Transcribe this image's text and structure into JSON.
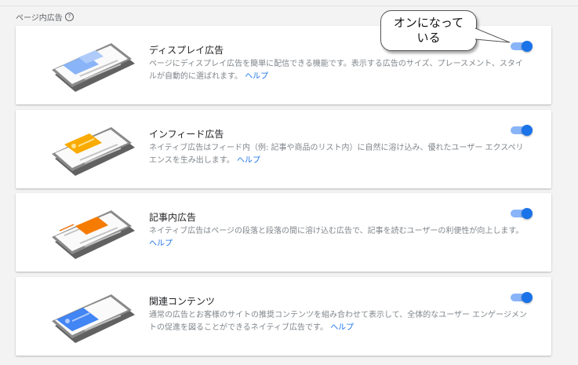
{
  "section": {
    "title": "ページ内広告",
    "help_icon": "help-circle-icon"
  },
  "callout": {
    "text": "オンになって\nいる"
  },
  "help_link": "ヘルプ",
  "accent_color": "#1a73e8",
  "cards": [
    {
      "title": "ディスプレイ広告",
      "desc": "ページにディスプレイ広告を簡単に配信できる機能です。表示する広告のサイズ、プレースメント、スタイルが自動的に選ばれます。",
      "enabled": true
    },
    {
      "title": "インフィード広告",
      "desc": "ネイティブ広告はフィード内（例: 記事や商品のリスト内）に自然に溶け込み、優れたユーザー エクスペリエンスを生み出します。",
      "enabled": true
    },
    {
      "title": "記事内広告",
      "desc": "ネイティブ広告はページの段落と段落の間に溶け込む広告で、記事を読むユーザーの利便性が向上します。",
      "enabled": true
    },
    {
      "title": "関連コンテンツ",
      "desc": "通常の広告とお客様のサイトの推奨コンテンツを組み合わせて表示して、全体的なユーザー エンゲージメントの促進を図ることができるネイティブ広告です。",
      "enabled": true
    }
  ]
}
